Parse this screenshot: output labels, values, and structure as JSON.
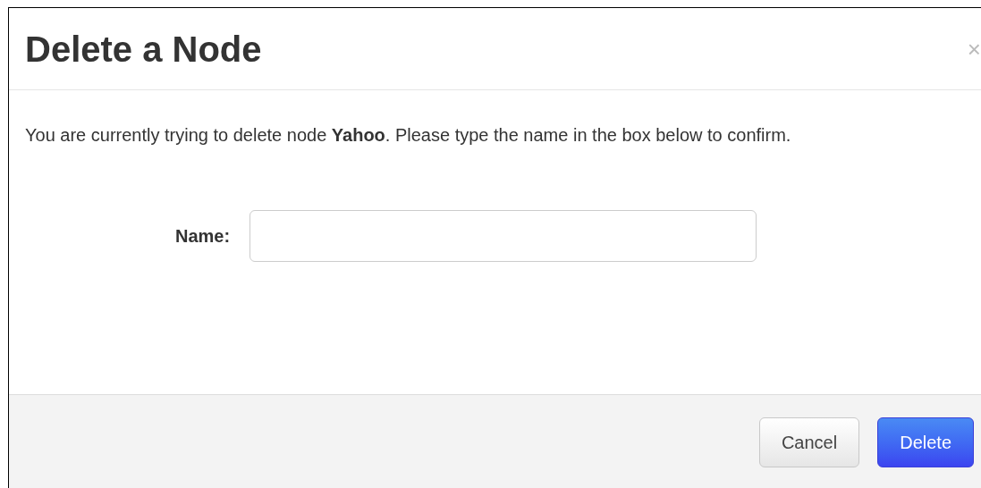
{
  "dialog": {
    "title": "Delete a Node",
    "close": "×",
    "message": "You are currently trying to delete node **Yahoo**. Please type the name in the box below to confirm.",
    "field": {
      "label": "Name:"
    },
    "buttons": [
      {
        "label": "Cancel",
        "kind": "secondary"
      },
      {
        "label": "Delete",
        "kind": "primary"
      }
    ]
  }
}
